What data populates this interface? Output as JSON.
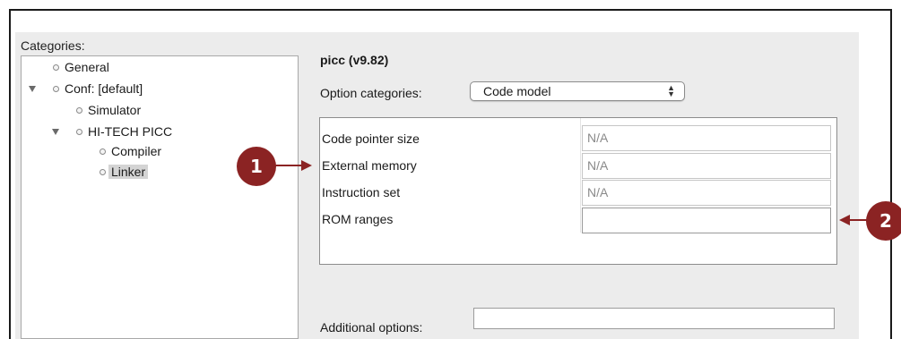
{
  "categories": {
    "label": "Categories:",
    "items": [
      {
        "label": "General"
      },
      {
        "label": "Conf: [default]"
      },
      {
        "label": "Simulator"
      },
      {
        "label": "HI-TECH PICC"
      },
      {
        "label": "Compiler"
      },
      {
        "label": "Linker"
      }
    ]
  },
  "options": {
    "title": "picc (v9.82)",
    "option_categories_label": "Option categories:",
    "option_categories_value": "Code model",
    "rows": [
      {
        "label": "Code pointer size",
        "value": "N/A"
      },
      {
        "label": "External memory",
        "value": "N/A"
      },
      {
        "label": "Instruction set",
        "value": "N/A"
      },
      {
        "label": "ROM ranges",
        "value": ""
      }
    ],
    "additional_label": "Additional options:",
    "additional_value": ""
  },
  "callouts": {
    "one": "1",
    "two": "2"
  },
  "colors": {
    "callout": "#8b2323",
    "panel": "#ececec"
  }
}
